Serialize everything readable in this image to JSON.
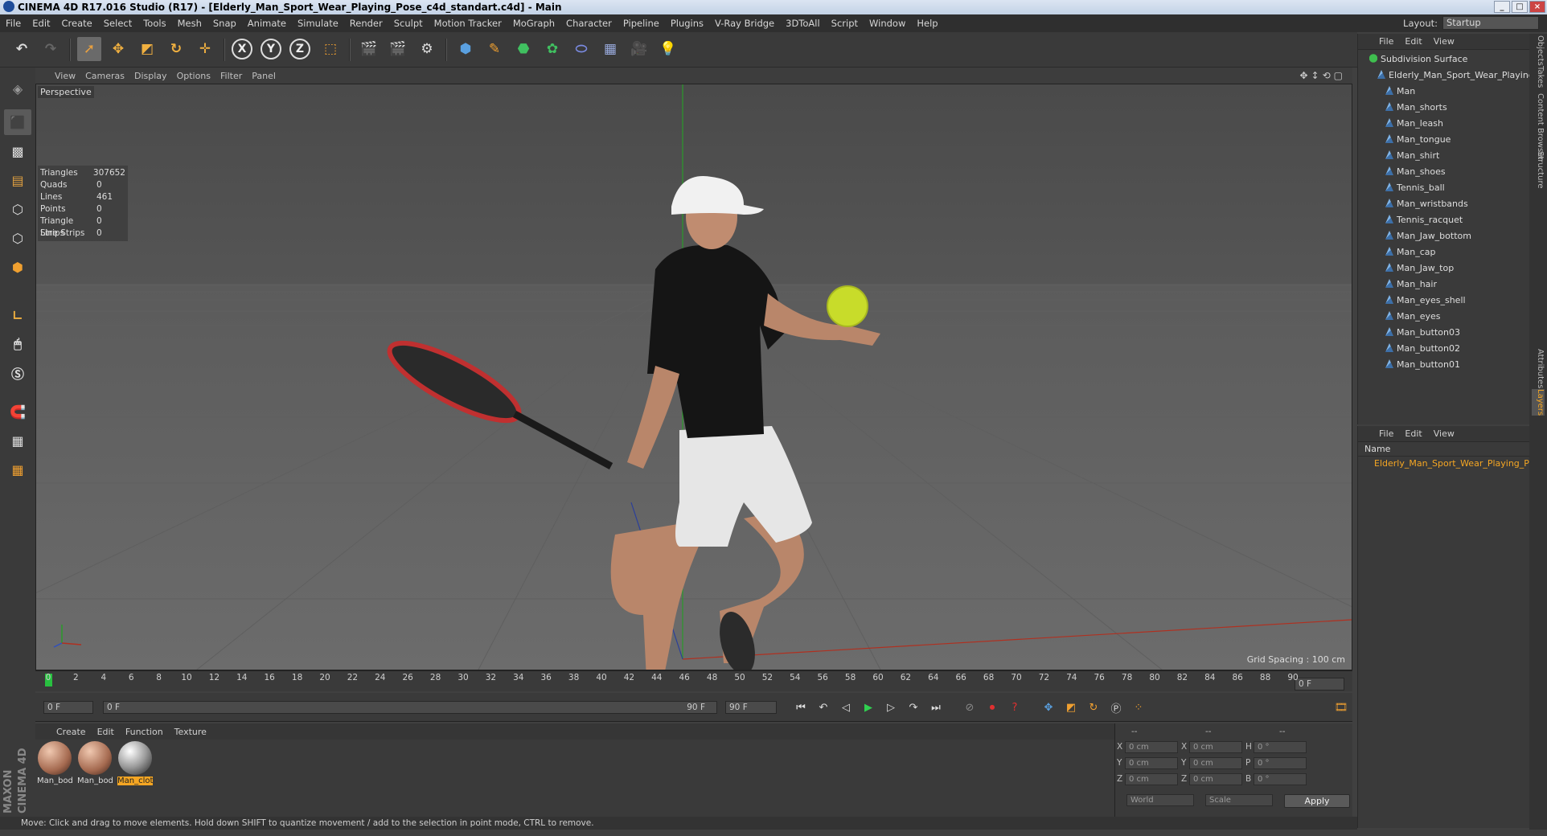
{
  "window": {
    "title": "CINEMA 4D R17.016 Studio (R17) - [Elderly_Man_Sport_Wear_Playing_Pose_c4d_standart.c4d] - Main"
  },
  "menu": [
    "File",
    "Edit",
    "Create",
    "Select",
    "Tools",
    "Mesh",
    "Snap",
    "Animate",
    "Simulate",
    "Render",
    "Sculpt",
    "Motion Tracker",
    "MoGraph",
    "Character",
    "Pipeline",
    "Plugins",
    "V-Ray Bridge",
    "3DToAll",
    "Script",
    "Window",
    "Help"
  ],
  "layout": {
    "label": "Layout:",
    "value": "Startup"
  },
  "viewport": {
    "menu": [
      "View",
      "Cameras",
      "Display",
      "Options",
      "Filter",
      "Panel"
    ],
    "camera_label": "Perspective",
    "stats": [
      {
        "k": "Triangles",
        "v": "307652"
      },
      {
        "k": "Quads",
        "v": "0"
      },
      {
        "k": "Lines",
        "v": "461"
      },
      {
        "k": "Points",
        "v": "0"
      },
      {
        "k": "Triangle Strips",
        "v": "0"
      },
      {
        "k": "Line Strips",
        "v": "0"
      }
    ],
    "grid_spacing": "Grid Spacing : 100 cm"
  },
  "objects_panel": {
    "menu": [
      "File",
      "Edit",
      "View"
    ],
    "items": [
      {
        "name": "Subdivision Surface",
        "level": 0,
        "root": true
      },
      {
        "name": "Elderly_Man_Sport_Wear_Playing_",
        "level": 1
      },
      {
        "name": "Man",
        "level": 2
      },
      {
        "name": "Man_shorts",
        "level": 2
      },
      {
        "name": "Man_leash",
        "level": 2
      },
      {
        "name": "Man_tongue",
        "level": 2
      },
      {
        "name": "Man_shirt",
        "level": 2
      },
      {
        "name": "Man_shoes",
        "level": 2
      },
      {
        "name": "Tennis_ball",
        "level": 2
      },
      {
        "name": "Man_wristbands",
        "level": 2
      },
      {
        "name": "Tennis_racquet",
        "level": 2
      },
      {
        "name": "Man_Jaw_bottom",
        "level": 2
      },
      {
        "name": "Man_cap",
        "level": 2
      },
      {
        "name": "Man_Jaw_top",
        "level": 2
      },
      {
        "name": "Man_hair",
        "level": 2
      },
      {
        "name": "Man_eyes_shell",
        "level": 2
      },
      {
        "name": "Man_eyes",
        "level": 2
      },
      {
        "name": "Man_button03",
        "level": 2
      },
      {
        "name": "Man_button02",
        "level": 2
      },
      {
        "name": "Man_button01",
        "level": 2
      }
    ]
  },
  "right_tabs": {
    "top": [
      "Objects",
      "Takes",
      "Content Browser",
      "Structure"
    ],
    "bottom": [
      "Attributes",
      "Layers"
    ]
  },
  "layers_panel": {
    "menu": [
      "File",
      "Edit",
      "View"
    ],
    "column": "Name",
    "item": "Elderly_Man_Sport_Wear_Playing_P"
  },
  "timeline": {
    "ticks": [
      "0",
      "2",
      "4",
      "6",
      "8",
      "10",
      "12",
      "14",
      "16",
      "18",
      "20",
      "22",
      "24",
      "26",
      "28",
      "30",
      "32",
      "34",
      "36",
      "38",
      "40",
      "42",
      "44",
      "46",
      "48",
      "50",
      "52",
      "54",
      "56",
      "58",
      "60",
      "62",
      "64",
      "66",
      "68",
      "70",
      "72",
      "74",
      "76",
      "78",
      "80",
      "82",
      "84",
      "86",
      "88",
      "90"
    ],
    "current_frame": "0 F"
  },
  "transport": {
    "start": "0 F",
    "slider_start": "0 F",
    "slider_end": "90 F",
    "end": "90 F"
  },
  "materials": {
    "menu": [
      "Create",
      "Edit",
      "Function",
      "Texture"
    ],
    "items": [
      {
        "name": "Man_bod",
        "selected": false,
        "kind": "skin"
      },
      {
        "name": "Man_bod",
        "selected": false,
        "kind": "skin"
      },
      {
        "name": "Man_clot",
        "selected": true,
        "kind": "cloth"
      }
    ]
  },
  "coords": {
    "headers": [
      "--",
      "--",
      "--"
    ],
    "pos": [
      {
        "l": "X",
        "v": "0 cm"
      },
      {
        "l": "Y",
        "v": "0 cm"
      },
      {
        "l": "Z",
        "v": "0 cm"
      }
    ],
    "size": [
      {
        "l": "X",
        "v": "0 cm"
      },
      {
        "l": "Y",
        "v": "0 cm"
      },
      {
        "l": "Z",
        "v": "0 cm"
      }
    ],
    "rot": [
      {
        "l": "H",
        "v": "0 °"
      },
      {
        "l": "P",
        "v": "0 °"
      },
      {
        "l": "B",
        "v": "0 °"
      }
    ],
    "mode1": "World",
    "mode2": "Scale",
    "apply": "Apply"
  },
  "status": "Move: Click and drag to move elements. Hold down SHIFT to quantize movement / add to the selection in point mode, CTRL to remove.",
  "brand": "MAXON CINEMA 4D",
  "colors": {
    "accent": "#f5a623",
    "playhead": "#28c040",
    "axis_x": "#c0392b",
    "axis_y": "#27ae60",
    "axis_z": "#3050c0"
  }
}
